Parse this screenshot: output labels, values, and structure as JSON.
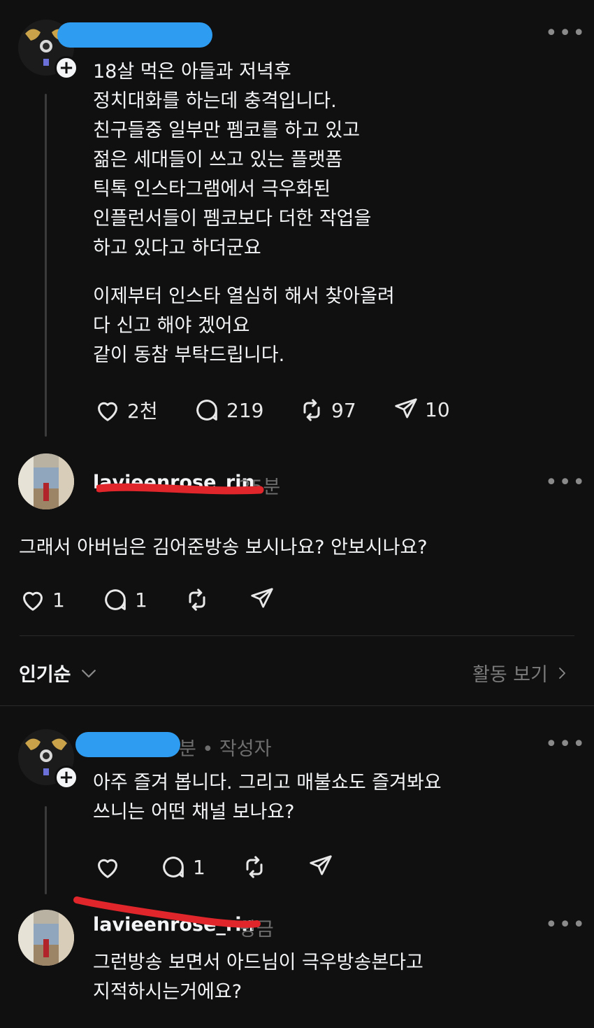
{
  "post": {
    "username_redacted": true,
    "body": "18살 먹은 아들과 저녁후\n정치대화를 하는데 충격입니다.\n친구들중 일부만 펨코를 하고 있고\n젊은 세대들이 쓰고 있는 플랫폼\n틱톡 인스타그램에서 극우화된\n인플런서들이 펨코보다 더한 작업을\n하고 있다고 하더군요",
    "body2": "이제부터 인스타 열심히 해서 찾아올려\n다 신고 해야 겠어요\n같이 동참 부탁드립니다.",
    "likes": "2천",
    "replies": "219",
    "reposts": "97",
    "shares": "10",
    "more": "•••"
  },
  "reply1": {
    "username": "lavieenrose_rin",
    "time": "25분",
    "body": "그래서 아버님은 김어준방송 보시나요? 안보시나요?",
    "likes": "1",
    "replies": "1",
    "more": "•••"
  },
  "sortbar": {
    "sort_label": "인기순",
    "activity_label": "활동 보기"
  },
  "reply2": {
    "meta": "분 • 작성자",
    "body": "아주 즐겨 봅니다. 그리고 매불쇼도 즐겨봐요\n쓰니는 어떤 채널 보나요?",
    "replies": "1",
    "more": "•••"
  },
  "reply3": {
    "username": "lavieenrose_rin",
    "time": "방금",
    "body": "그런방송 보면서 아드님이 극우방송본다고\n지적하시는거에요?",
    "more": "•••"
  },
  "icons": {
    "heart": "heart-icon",
    "comment": "comment-icon",
    "repost": "repost-icon",
    "share": "send-icon",
    "chevron_down": "chevron-down-icon",
    "chevron_right": "chevron-right-icon",
    "plus": "plus-icon"
  },
  "colors": {
    "background": "#101010",
    "text": "#f3f5f7",
    "muted": "#6e6e6e",
    "redaction_blue": "#2e9cf0",
    "redaction_red": "#e0262b"
  }
}
